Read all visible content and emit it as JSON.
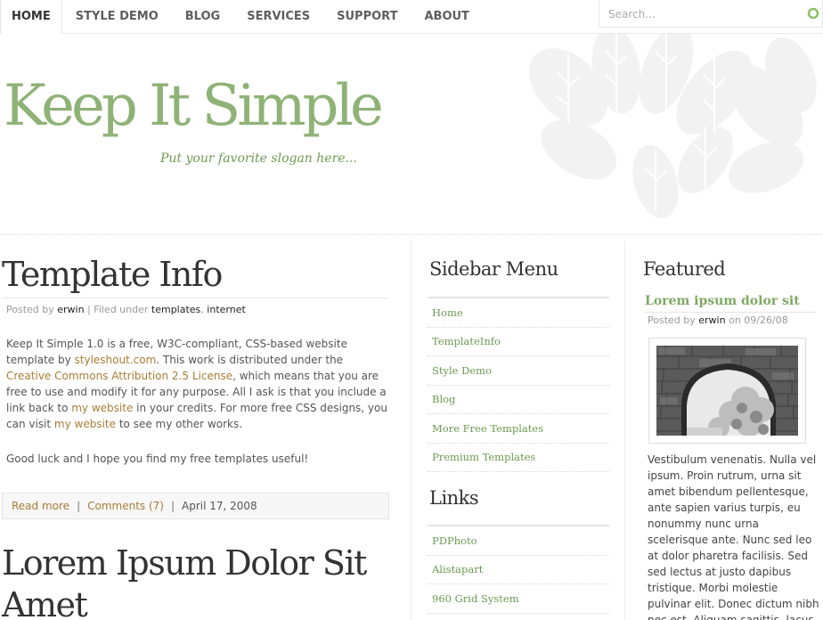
{
  "nav": {
    "items": [
      "Home",
      "Style Demo",
      "Blog",
      "Services",
      "Support",
      "About"
    ],
    "active": "Home"
  },
  "search": {
    "placeholder": "Search..."
  },
  "header": {
    "title": "Keep It Simple",
    "slogan": "Put your favorite slogan here..."
  },
  "posts": [
    {
      "title": "Template Info",
      "posted_by_label": "Posted by",
      "author": "erwin",
      "filed_under_label": "| Filed under",
      "tags": [
        "templates",
        "internet"
      ],
      "paragraph1": {
        "t1": "Keep It Simple 1.0 is a free, W3C-compliant, CSS-based website template by ",
        "link1": "styleshout.com",
        "t2": ". This work is distributed under the ",
        "link2": "Creative Commons Attribution 2.5 License",
        "t3": ", which means that you are free to use and modify it for any purpose. All I ask is that you include a link back to ",
        "link3": "my website",
        "t4": " in your credits. For more free CSS designs, you can visit ",
        "link4": "my website",
        "t5": " to see my other works."
      },
      "paragraph2": "Good luck and I hope you find my free templates useful!",
      "footer": {
        "read_more": "Read more",
        "comments": "Comments (7)",
        "date": "April 17, 2008"
      }
    },
    {
      "title_line1": "Lorem Ipsum Dolor Sit",
      "title_line2": "Amet"
    }
  ],
  "sidebar": {
    "menu_heading": "Sidebar Menu",
    "menu_items": [
      "Home",
      "TemplateInfo",
      "Style Demo",
      "Blog",
      "More Free Templates",
      "Premium Templates"
    ],
    "links_heading": "Links",
    "links_items": [
      "PDPhoto",
      "Alistapart",
      "960 Grid System"
    ]
  },
  "featured": {
    "heading": "Featured",
    "post_title": "Lorem ipsum dolor sit",
    "posted_by_label": "Posted by",
    "author": "erwin",
    "date_label": "on 09/26/08",
    "body": "Vestibulum venenatis. Nulla vel ipsum. Proin rutrum, urna sit amet bibendum pellentesque, ante sapien varius turpis, eu nonummy nunc urna scelerisque ante. Nunc sed leo at dolor pharetra facilisis. Sed sed lectus at justo dapibus tristique. Morbi molestie pulvinar elit. Donec dictum nibh nec est. Aliquam sagittis, lacus a pharetra tempor"
  },
  "colors": {
    "accent_green": "#8fb276",
    "link_green": "#6a9a52",
    "link_brown": "#a87d35"
  }
}
